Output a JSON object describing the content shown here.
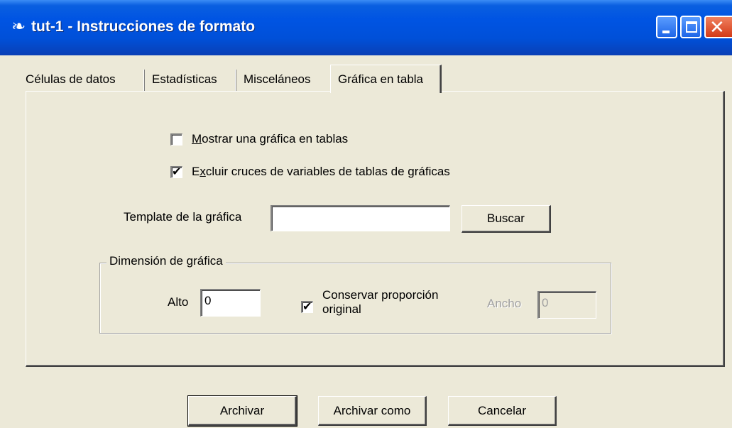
{
  "window": {
    "title": "tut-1 - Instrucciones de formato",
    "icon": "app-icon"
  },
  "tabs": [
    {
      "label": "Células de datos"
    },
    {
      "label": "Estadísticas"
    },
    {
      "label": "Misceláneos"
    },
    {
      "label": "Gráfica en tabla",
      "active": true
    }
  ],
  "options": {
    "show_chart": {
      "label": "Mostrar una gráfica en tablas",
      "checked": false
    },
    "exclude_crosses": {
      "label": "Excluir cruces de variables de tablas de gráficas",
      "checked": true
    }
  },
  "template": {
    "label": "Template de la gráfica",
    "value": "",
    "browse_label": "Buscar"
  },
  "dimension": {
    "group_title": "Dimensión de gráfica",
    "height_label": "Alto",
    "height_value": "0",
    "keep_ratio_label_1": "Conservar proporción",
    "keep_ratio_label_2": "original",
    "keep_ratio_checked": true,
    "width_label": "Ancho",
    "width_value": "0"
  },
  "footer": {
    "save_label": "Archivar",
    "save_as_label": "Archivar como",
    "cancel_label": "Cancelar"
  },
  "colors": {
    "titlebar": "#0054e3",
    "dialog_bg": "#ece9d8",
    "close_button": "#d33a17"
  }
}
